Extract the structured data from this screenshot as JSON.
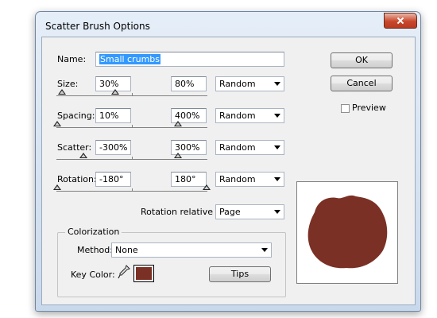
{
  "window": {
    "title": "Scatter Brush Options"
  },
  "name": {
    "label": "Name:",
    "value": "Small crumbs"
  },
  "rows": {
    "size": {
      "label": "Size:",
      "min": "30%",
      "max": "80%",
      "variation": "Random"
    },
    "spacing": {
      "label": "Spacing:",
      "min": "10%",
      "max": "400%",
      "variation": "Random"
    },
    "scatter": {
      "label": "Scatter:",
      "min": "-300%",
      "max": "300%",
      "variation": "Random"
    },
    "rotation": {
      "label": "Rotation:",
      "min": "-180°",
      "max": "180°",
      "variation": "Random"
    }
  },
  "rotation_relative": {
    "label": "Rotation relative to:",
    "value": "Page"
  },
  "colorization": {
    "title": "Colorization",
    "method_label": "Method:",
    "method_value": "None",
    "key_color_label": "Key Color:",
    "tips_label": "Tips"
  },
  "buttons": {
    "ok": "OK",
    "cancel": "Cancel"
  },
  "preview": {
    "label": "Preview",
    "checked": false
  },
  "colors": {
    "key_color": "#7b3025",
    "preview_shape": "#7b3025"
  },
  "icons": {
    "eyedropper": "eyedropper-icon",
    "close": "close-icon"
  }
}
